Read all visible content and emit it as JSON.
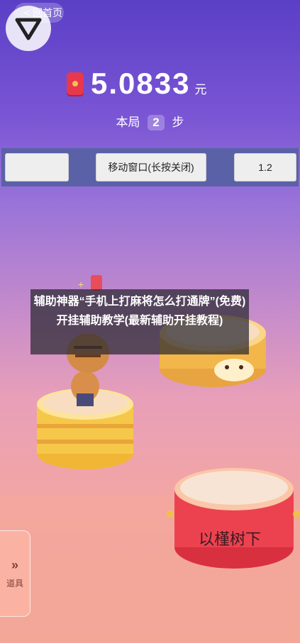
{
  "header": {
    "back_label": "< 回首页",
    "logo_icon": "triangle-down-icon"
  },
  "money": {
    "value": "5.0833",
    "unit": "元",
    "icon": "red-packet-icon"
  },
  "step": {
    "prefix": "本局",
    "count": "2",
    "suffix": "步"
  },
  "toolbar": {
    "left_button": "",
    "move_window_button": "移动窗口(长按关闭)",
    "speed_button": "1.2"
  },
  "overlay": {
    "title": "辅助神器“手机上打麻将怎么打通牌”(免费)开挂辅助教学(最新辅助开挂教程)"
  },
  "drum": {
    "text": "以槿树下"
  },
  "side_tab": {
    "chevron": "»",
    "label": "道具"
  },
  "colors": {
    "bg_top": "#5a3fc6",
    "bg_bottom": "#f2a694",
    "toolbar": "#5b61a6",
    "red_packet": "#e7384d"
  }
}
